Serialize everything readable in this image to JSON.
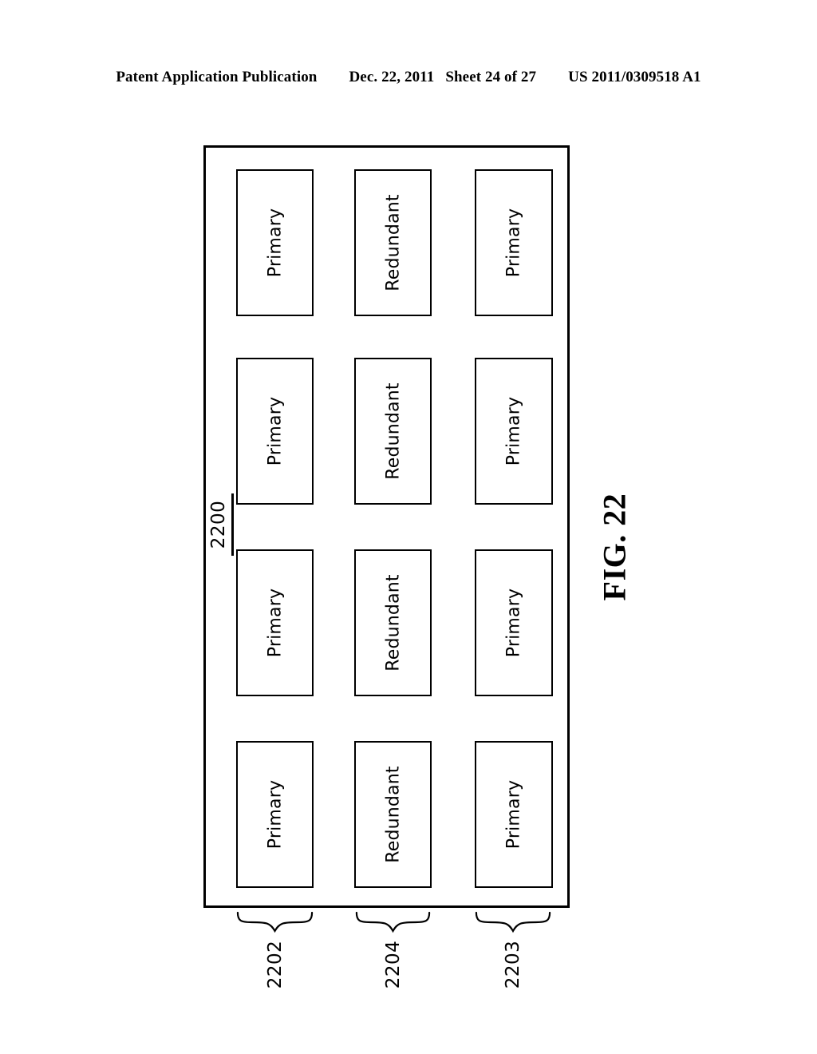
{
  "header": {
    "publication": "Patent Application Publication",
    "date": "Dec. 22, 2011",
    "sheet": "Sheet 24 of 27",
    "serial": "US 2011/0309518 A1"
  },
  "figure": {
    "caption": "FIG. 22",
    "outer_ref": "2200",
    "bands": [
      {
        "cells": [
          {
            "label": "Primary"
          },
          {
            "label": "Redundant"
          },
          {
            "label": "Primary"
          }
        ]
      },
      {
        "cells": [
          {
            "label": "Primary"
          },
          {
            "label": "Redundant"
          },
          {
            "label": "Primary"
          }
        ]
      },
      {
        "cells": [
          {
            "label": "Primary"
          },
          {
            "label": "Redundant"
          },
          {
            "label": "Primary"
          }
        ]
      },
      {
        "cells": [
          {
            "label": "Primary"
          },
          {
            "label": "Redundant"
          },
          {
            "label": "Primary"
          }
        ]
      }
    ],
    "braces": [
      {
        "ref": "2202"
      },
      {
        "ref": "2204"
      },
      {
        "ref": "2203"
      }
    ]
  }
}
